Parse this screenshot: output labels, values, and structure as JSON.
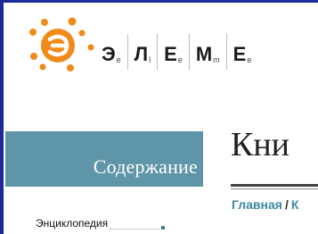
{
  "brand": {
    "letters": [
      {
        "big": "Э",
        "sub": "e"
      },
      {
        "big": "Л",
        "sub": "l"
      },
      {
        "big": "Е",
        "sub": "e"
      },
      {
        "big": "М",
        "sub": "m"
      },
      {
        "big": "Е",
        "sub": "e"
      }
    ],
    "colors": {
      "orange": "#f08a19",
      "frame": "#1e2a9b"
    }
  },
  "sidebar": {
    "heading": "Содержание",
    "items": [
      {
        "label": "Энциклопедия"
      }
    ]
  },
  "main": {
    "title": "Кни",
    "breadcrumb": {
      "home": "Главная",
      "separator": "/",
      "next": "К"
    }
  },
  "colors": {
    "toc_bar": "#5f95a8",
    "link": "#3d8aa3"
  }
}
